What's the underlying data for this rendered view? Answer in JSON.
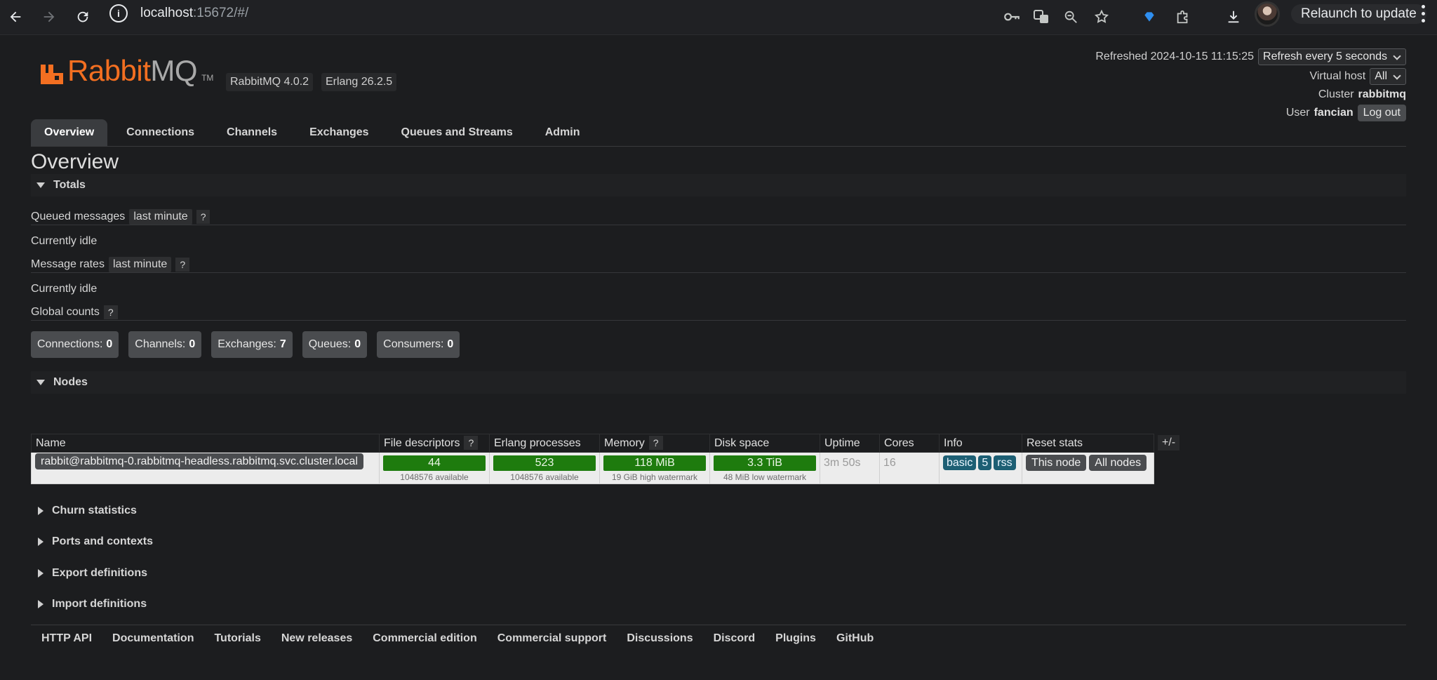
{
  "browser": {
    "url_host": "localhost",
    "url_rest": ":15672/#/",
    "relaunch_label": "Relaunch to update"
  },
  "header": {
    "logo_rabbit": "Rabbit",
    "logo_mq": "MQ",
    "logo_tm": "TM",
    "rabbitmq_version": "RabbitMQ 4.0.2",
    "erlang_version": "Erlang 26.2.5",
    "refreshed_label": "Refreshed 2024-10-15 11:15:25",
    "refresh_select": "Refresh every 5 seconds",
    "vhost_label": "Virtual host",
    "vhost_select": "All",
    "cluster_label": "Cluster",
    "cluster_name": "rabbitmq",
    "user_label": "User",
    "user_name": "fancian",
    "logout_label": "Log out"
  },
  "tabs": [
    {
      "label": "Overview"
    },
    {
      "label": "Connections"
    },
    {
      "label": "Channels"
    },
    {
      "label": "Exchanges"
    },
    {
      "label": "Queues and Streams"
    },
    {
      "label": "Admin"
    }
  ],
  "page_title": "Overview",
  "totals": {
    "section_label": "Totals",
    "queued_label": "Queued messages",
    "queued_range": "last minute",
    "help": "?",
    "idle1": "Currently idle",
    "rates_label": "Message rates",
    "rates_range": "last minute",
    "idle2": "Currently idle",
    "global_label": "Global counts",
    "counts": [
      {
        "label": "Connections:",
        "value": "0"
      },
      {
        "label": "Channels:",
        "value": "0"
      },
      {
        "label": "Exchanges:",
        "value": "7"
      },
      {
        "label": "Queues:",
        "value": "0"
      },
      {
        "label": "Consumers:",
        "value": "0"
      }
    ]
  },
  "nodes": {
    "section_label": "Nodes",
    "headers": {
      "name": "Name",
      "fd": "File descriptors",
      "erl": "Erlang processes",
      "mem": "Memory",
      "disk": "Disk space",
      "uptime": "Uptime",
      "cores": "Cores",
      "info": "Info",
      "reset": "Reset stats"
    },
    "plusminus": "+/-",
    "row": {
      "name": "rabbit@rabbitmq-0.rabbitmq-headless.rabbitmq.svc.cluster.local",
      "fd_value": "44",
      "fd_sub": "1048576 available",
      "erl_value": "523",
      "erl_sub": "1048576 available",
      "mem_value": "118 MiB",
      "mem_sub": "19 GiB high watermark",
      "disk_value": "3.3 TiB",
      "disk_sub": "48 MiB low watermark",
      "uptime": "3m 50s",
      "cores": "16",
      "info_badges": [
        "basic",
        "5",
        "rss"
      ],
      "reset_this": "This node",
      "reset_all": "All nodes"
    }
  },
  "collapsed_sections": [
    {
      "label": "Churn statistics"
    },
    {
      "label": "Ports and contexts"
    },
    {
      "label": "Export definitions"
    },
    {
      "label": "Import definitions"
    }
  ],
  "footer_links": [
    {
      "label": "HTTP API"
    },
    {
      "label": "Documentation"
    },
    {
      "label": "Tutorials"
    },
    {
      "label": "New releases"
    },
    {
      "label": "Commercial edition"
    },
    {
      "label": "Commercial support"
    },
    {
      "label": "Discussions"
    },
    {
      "label": "Discord"
    },
    {
      "label": "Plugins"
    },
    {
      "label": "GitHub"
    }
  ],
  "colors": {
    "brand_orange": "#f36f21",
    "ok_green": "#1e7b0e",
    "info_badge": "#1d5f74",
    "background": "#1c1d1f"
  }
}
